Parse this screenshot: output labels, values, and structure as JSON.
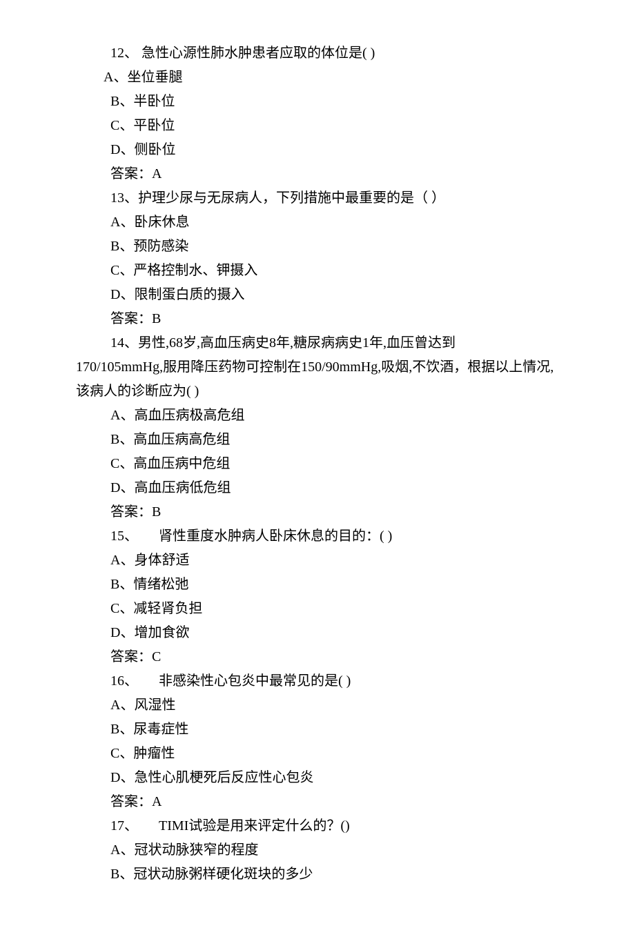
{
  "q12": {
    "stem": "12、 急性心源性肺水肿患者应取的体位是( )",
    "opt_a": "A、坐位垂腿",
    "opt_b": "B、半卧位",
    "opt_c": "C、平卧位",
    "opt_d": "D、侧卧位",
    "answer": "答案：A"
  },
  "q13": {
    "stem": "13、护理少尿与无尿病人，下列措施中最重要的是（ ）",
    "opt_a": "A、卧床休息",
    "opt_b": "B、预防感染",
    "opt_c": "C、严格控制水、钾摄入",
    "opt_d": "D、限制蛋白质的摄入",
    "answer": "答案：B"
  },
  "q14": {
    "stem_line1": "14、男性,68岁,高血压病史8年,糖尿病病史1年,血压曾达到",
    "stem_line2": "170/105mmHg,服用降压药物可控制在150/90mmHg,吸烟,不饮酒，根据以上情况,该病人的诊断应为( )",
    "opt_a": "A、高血压病极高危组",
    "opt_b": "B、高血压病高危组",
    "opt_c": "C、高血压病中危组",
    "opt_d": "D、高血压病低危组",
    "answer": "答案：B"
  },
  "q15": {
    "stem": "15、　　肾性重度水肿病人卧床休息的目的：( )",
    "opt_a": "A、身体舒适",
    "opt_b": "B、情绪松弛",
    "opt_c": "C、减轻肾负担",
    "opt_d": "D、增加食欲",
    "answer": "答案：C"
  },
  "q16": {
    "stem": "16、　　非感染性心包炎中最常见的是( )",
    "opt_a": "A、风湿性",
    "opt_b": "B、尿毒症性",
    "opt_c": "C、肿瘤性",
    "opt_d": "D、急性心肌梗死后反应性心包炎",
    "answer": "答案：A"
  },
  "q17": {
    "stem": "17、　　TIMI试验是用来评定什么的？()",
    "opt_a": "A、冠状动脉狭窄的程度",
    "opt_b": "B、冠状动脉粥样硬化斑块的多少"
  }
}
